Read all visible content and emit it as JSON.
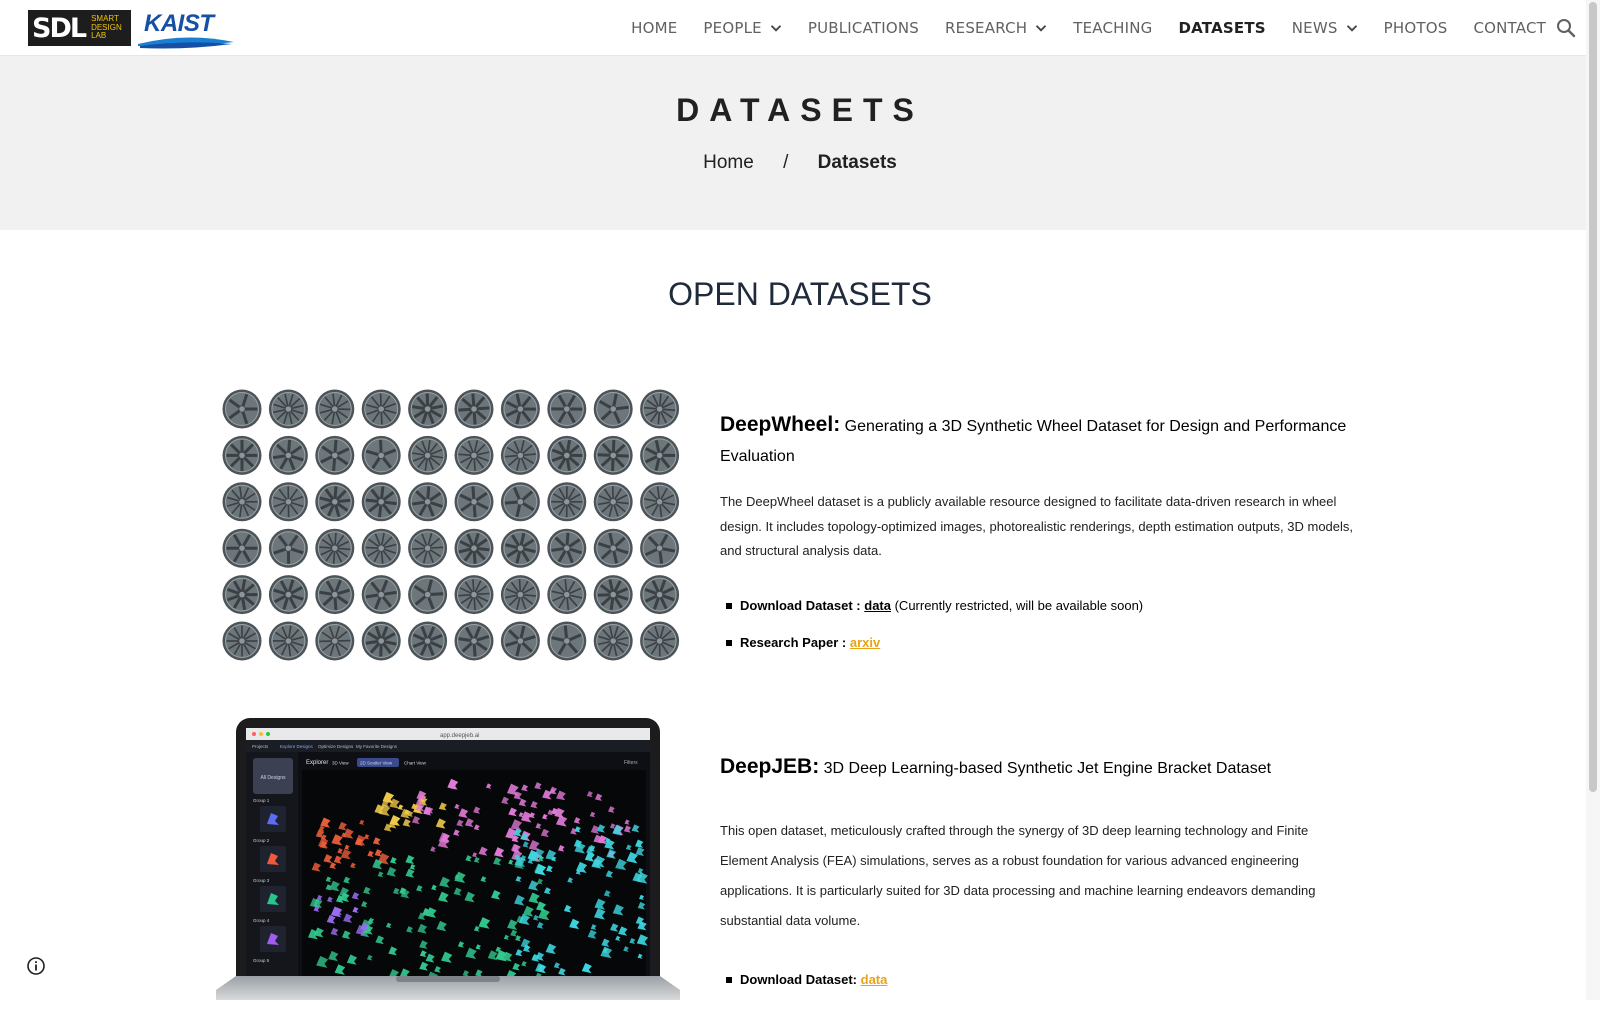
{
  "logos": {
    "sdl_mark": "SDL",
    "sdl_words": [
      "SMART",
      "DESIGN",
      "LAB"
    ],
    "kaist": "KAIST"
  },
  "nav": {
    "items": [
      {
        "label": "HOME",
        "dropdown": false,
        "active": false
      },
      {
        "label": "PEOPLE",
        "dropdown": true,
        "active": false
      },
      {
        "label": "PUBLICATIONS",
        "dropdown": false,
        "active": false
      },
      {
        "label": "RESEARCH",
        "dropdown": true,
        "active": false
      },
      {
        "label": "TEACHING",
        "dropdown": false,
        "active": false
      },
      {
        "label": "DATASETS",
        "dropdown": false,
        "active": true
      },
      {
        "label": "NEWS",
        "dropdown": true,
        "active": false
      },
      {
        "label": "PHOTOS",
        "dropdown": false,
        "active": false
      },
      {
        "label": "CONTACT",
        "dropdown": false,
        "active": false
      }
    ],
    "search_icon": "search-icon"
  },
  "hero": {
    "title": "DATASETS",
    "breadcrumb": {
      "home": "Home",
      "separator": "/",
      "current": "Datasets"
    }
  },
  "section_title": "OPEN DATASETS",
  "datasets": [
    {
      "name": "DeepWheel:",
      "subtitle": "Generating a 3D Synthetic Wheel Dataset for Design and Performance Evaluation",
      "description": "The DeepWheel dataset is a publicly available resource designed to facilitate data-driven research in wheel design. It includes topology-optimized images, photorealistic renderings, depth estimation outputs, 3D models, and structural analysis data.",
      "bullets": [
        {
          "label": "Download Dataset : ",
          "link": "data",
          "note": " (Currently restricted, will be available soon)"
        },
        {
          "label": "Research Paper : ",
          "link": "arxiv",
          "note": ""
        }
      ]
    },
    {
      "name": "DeepJEB:",
      "subtitle": "3D Deep Learning-based Synthetic Jet Engine Bracket Dataset",
      "description": "This open dataset, meticulously crafted through the synergy of 3D deep learning technology and Finite Element Analysis (FEA) simulations, serves as a robust foundation for various advanced engineering applications. It is particularly suited for 3D data processing and machine learning endeavors demanding substantial data volume.",
      "bullets": [
        {
          "label": "Download Dataset: ",
          "link": "data",
          "note": ""
        }
      ]
    }
  ],
  "laptop_ui": {
    "url": "app.deepjeb.ai",
    "tabs": [
      "Projects",
      "Explore Designs",
      "Optimize Designs",
      "My Favorite Designs"
    ],
    "panel_title": "Explorer",
    "view_buttons": [
      "3D View",
      "2D Scatter View",
      "Chart View"
    ],
    "filters_label": "Filters",
    "all_designs": "All Designs",
    "groups": [
      "Group 1",
      "Group 2",
      "Group 3",
      "Group 4",
      "Group 5"
    ]
  },
  "colors": {
    "hero_bg": "#f1f1f1",
    "link_orange": "#e8a317",
    "kaist_blue": "#154fa6",
    "sdl_yellow": "#f2c400"
  }
}
